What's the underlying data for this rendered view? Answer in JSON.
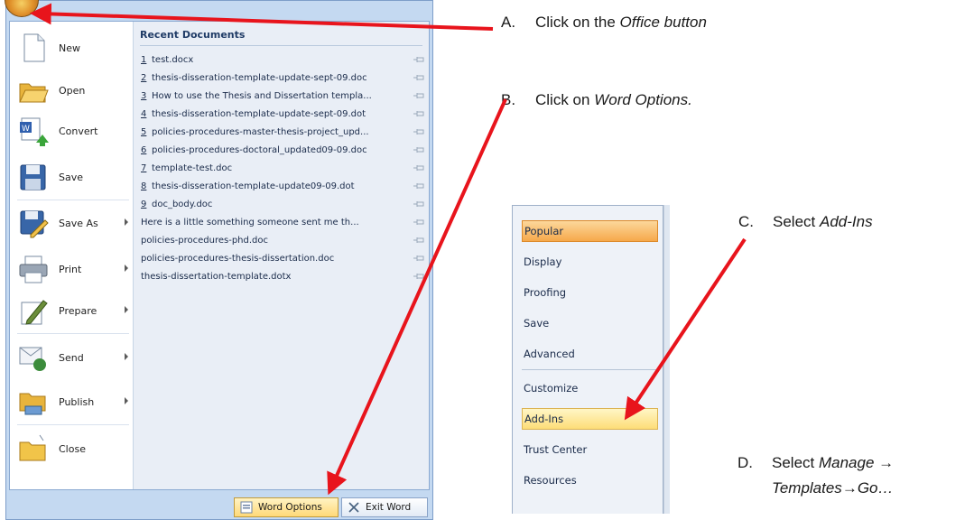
{
  "office_menu": {
    "commands": [
      {
        "label": "New",
        "icon": "new-document-icon",
        "submenu": false
      },
      {
        "label": "Open",
        "icon": "open-folder-icon",
        "submenu": false
      },
      {
        "label": "Convert",
        "icon": "convert-icon",
        "submenu": false
      },
      {
        "label": "Save",
        "icon": "save-disk-icon",
        "submenu": false
      },
      {
        "label": "Save As",
        "icon": "save-as-icon",
        "submenu": true
      },
      {
        "label": "Print",
        "icon": "printer-icon",
        "submenu": true
      },
      {
        "label": "Prepare",
        "icon": "prepare-pen-icon",
        "submenu": true
      },
      {
        "label": "Send",
        "icon": "send-icon",
        "submenu": true
      },
      {
        "label": "Publish",
        "icon": "publish-folder-icon",
        "submenu": true
      },
      {
        "label": "Close",
        "icon": "close-folder-icon",
        "submenu": false
      }
    ],
    "recent_title": "Recent Documents",
    "recent_documents": [
      {
        "num": "1",
        "name": "test.docx"
      },
      {
        "num": "2",
        "name": "thesis-disseration-template-update-sept-09.doc"
      },
      {
        "num": "3",
        "name": "How to use the Thesis and Dissertation templa..."
      },
      {
        "num": "4",
        "name": "thesis-disseration-template-update-sept-09.dot"
      },
      {
        "num": "5",
        "name": "policies-procedures-master-thesis-project_upd..."
      },
      {
        "num": "6",
        "name": "policies-procedures-doctoral_updated09-09.doc"
      },
      {
        "num": "7",
        "name": "template-test.doc"
      },
      {
        "num": "8",
        "name": "thesis-disseration-template-update09-09.dot"
      },
      {
        "num": "9",
        "name": "doc_body.doc"
      },
      {
        "num": "",
        "name": "Here is a little something someone sent me th..."
      },
      {
        "num": "",
        "name": "policies-procedures-phd.doc"
      },
      {
        "num": "",
        "name": "policies-procedures-thesis-dissertation.doc"
      },
      {
        "num": "",
        "name": "thesis-dissertation-template.dotx"
      }
    ],
    "footer": {
      "word_options": "Word Options",
      "exit_word": "Exit Word"
    }
  },
  "instructions": {
    "a": {
      "letter": "A.",
      "text": "Click on the ",
      "em": "Office button"
    },
    "b": {
      "letter": "B.",
      "text": "Click on ",
      "em": "Word Options."
    },
    "c": {
      "letter": "C.",
      "text": "Select ",
      "em": "Add-Ins"
    },
    "d": {
      "letter": "D.",
      "text": "Select ",
      "em": "Manage",
      "line2": "Templates",
      "line2b": "Go…"
    }
  },
  "word_options_categories": [
    {
      "label": "Popular",
      "state": "selected"
    },
    {
      "label": "Display",
      "state": "normal"
    },
    {
      "label": "Proofing",
      "state": "normal"
    },
    {
      "label": "Save",
      "state": "normal"
    },
    {
      "label": "Advanced",
      "state": "normal"
    },
    {
      "label": "Customize",
      "state": "normal"
    },
    {
      "label": "Add-Ins",
      "state": "hover"
    },
    {
      "label": "Trust Center",
      "state": "normal"
    },
    {
      "label": "Resources",
      "state": "normal"
    }
  ],
  "colors": {
    "arrow": "#e8141c",
    "selected": "#f6a94b",
    "hover": "#fddd78"
  }
}
